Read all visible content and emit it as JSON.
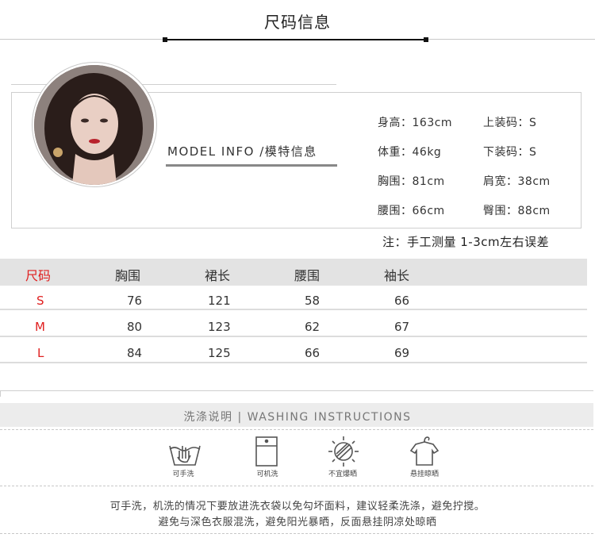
{
  "header": {
    "title": "尺码信息"
  },
  "model": {
    "label": "MODEL INFO /模特信息",
    "stats": [
      [
        "身高：163cm",
        "上装码：S"
      ],
      [
        "体重：46kg",
        "下装码：S"
      ],
      [
        "胸围：81cm",
        "肩宽：38cm"
      ],
      [
        "腰围：66cm",
        "臀围：88cm"
      ]
    ],
    "note": "注：手工测量 1-3cm左右误差"
  },
  "size_table": {
    "headers": [
      "尺码",
      "胸围",
      "裙长",
      "腰围",
      "袖长"
    ],
    "rows": [
      [
        "S",
        "76",
        "121",
        "58",
        "66"
      ],
      [
        "M",
        "80",
        "123",
        "62",
        "67"
      ],
      [
        "L",
        "84",
        "125",
        "66",
        "69"
      ]
    ]
  },
  "washing": {
    "title": "洗涤说明 | WASHING INSTRUCTIONS",
    "icons": [
      {
        "name": "hand-wash-icon",
        "label": "可手洗"
      },
      {
        "name": "machine-wash-icon",
        "label": "可机洗"
      },
      {
        "name": "no-sun-icon",
        "label": "不宜爆晒"
      },
      {
        "name": "hang-dry-icon",
        "label": "悬挂晾晒"
      }
    ],
    "description": [
      "可手洗，机洗的情况下要放进洗衣袋以免勾坏面料，建议轻柔洗涤，避免拧搅。",
      "避免与深色衣服混洗，避免阳光暴晒，反面悬挂阴凉处晾晒"
    ]
  },
  "colors": {
    "accent": "#e02020",
    "header_bg": "#e3e3e3"
  }
}
